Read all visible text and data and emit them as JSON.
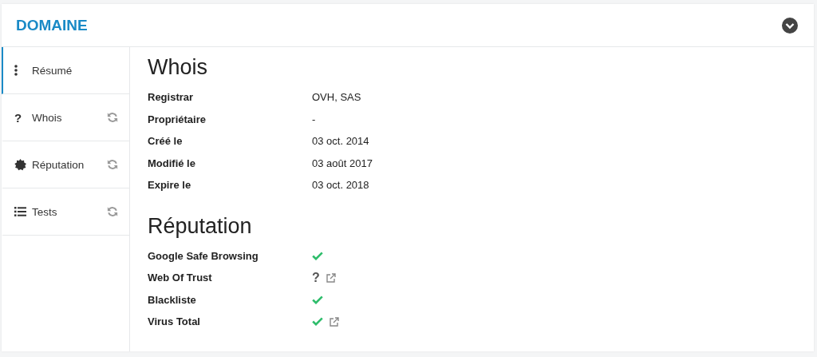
{
  "header": {
    "title": "DOMAINE",
    "expanded": false
  },
  "sidebar": {
    "items": [
      {
        "label": "Résumé",
        "kind": "dots",
        "selected": true,
        "refresh": false
      },
      {
        "label": "Whois",
        "kind": "glyph",
        "glyph": "?",
        "selected": false,
        "refresh": true
      },
      {
        "label": "Réputation",
        "kind": "badge",
        "selected": false,
        "refresh": true
      },
      {
        "label": "Tests",
        "kind": "list",
        "selected": false,
        "refresh": true
      }
    ]
  },
  "whois": {
    "title": "Whois",
    "rows": [
      {
        "label": "Registrar",
        "value": "OVH, SAS"
      },
      {
        "label": "Propriétaire",
        "value": "-"
      },
      {
        "label": "Créé le",
        "value": "03 oct. 2014"
      },
      {
        "label": "Modifié le",
        "value": "03 août 2017"
      },
      {
        "label": "Expire le",
        "value": "03 oct. 2018"
      }
    ]
  },
  "reputation": {
    "title": "Réputation",
    "rows": [
      {
        "label": "Google Safe Browsing",
        "kind": "ok",
        "link": false
      },
      {
        "label": "Web Of Trust",
        "kind": "unknown",
        "symbol": "?",
        "link": true
      },
      {
        "label": "Blackliste",
        "kind": "ok",
        "link": false
      },
      {
        "label": "Virus Total",
        "kind": "ok",
        "link": true
      }
    ]
  }
}
